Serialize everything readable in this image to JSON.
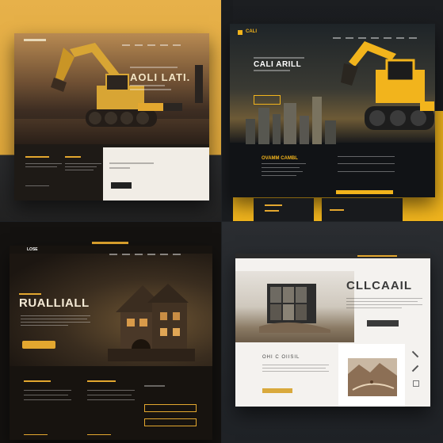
{
  "mockups": [
    {
      "logo": "",
      "hero_title": "AOLI LATI.",
      "hero_subtitle": "",
      "section_left_heading": "",
      "section_mid_heading": "",
      "card_heading": "",
      "accent": "#e3a72f"
    },
    {
      "logo": "CALI",
      "hero_title": "CALI ARILL",
      "hero_subtitle": "",
      "section_heading": "OVAMM CAMBL",
      "accent": "#f2b41c"
    },
    {
      "logo": "LOSE",
      "hero_title": "RUALLIALL",
      "section_left_heading": "",
      "section_mid_heading": "",
      "section_right_heading": "",
      "accent": "#e3a72f"
    },
    {
      "hero_title": "CLLCAAIL",
      "section_heading": "OHI C OIISIL",
      "accent": "#d9a93c"
    }
  ],
  "colors": {
    "gold": "#e3a72f",
    "dark": "#15171a",
    "cream": "#f1ede6"
  },
  "icons": [
    "excavator-icon",
    "house-icon",
    "building-icon",
    "map-icon"
  ]
}
